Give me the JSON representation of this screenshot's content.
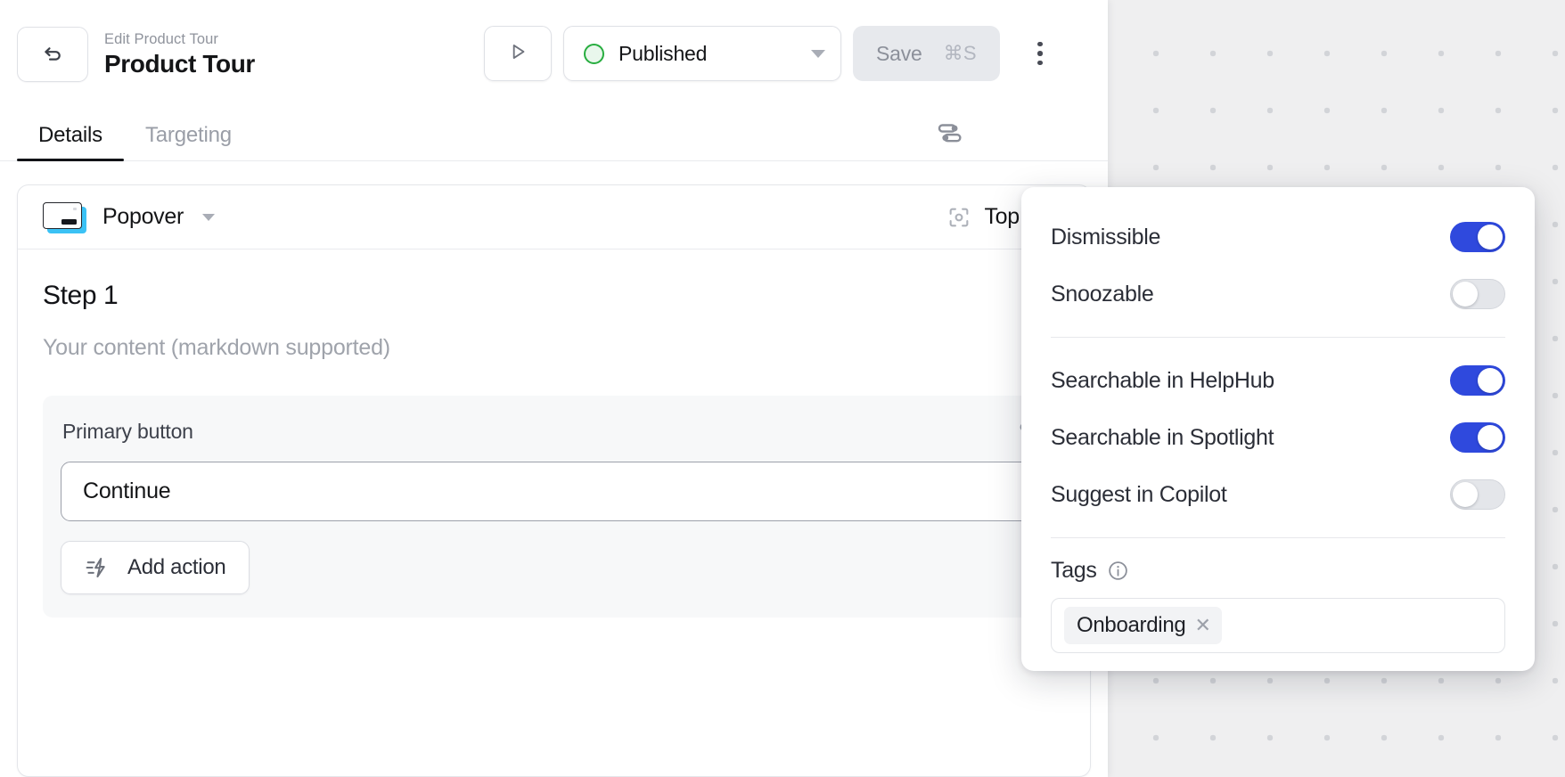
{
  "topbar": {
    "back_icon": "undo-arrow-icon",
    "eyebrow": "Edit Product Tour",
    "title": "Product Tour",
    "preview_icon": "play-triangle-icon",
    "status": {
      "label": "Published",
      "dot_color": "#27ad3f",
      "dot_fill": "#e9f7ec",
      "caret_icon": "chevron-down-icon"
    },
    "save": {
      "label": "Save",
      "shortcut": "⌘S",
      "disabled": true
    },
    "kebab_icon": "more-vertical-icon"
  },
  "tabs": {
    "items": [
      {
        "label": "Details",
        "active": true
      },
      {
        "label": "Targeting",
        "active": false
      }
    ],
    "settings_icon": "sliders-icon"
  },
  "step_card": {
    "type": {
      "icon": "popover-card-icon",
      "label": "Popover",
      "caret_icon": "chevron-down-icon"
    },
    "position": {
      "icon": "target-frame-icon",
      "label": "Top Left"
    },
    "step_title": "Step 1",
    "content_placeholder": "Your content (markdown supported)",
    "button_section": {
      "title": "Primary button",
      "settings_icon": "sliders-icon",
      "input_value": "Continue",
      "add_action": {
        "icon": "lightning-action-icon",
        "label": "Add action"
      }
    }
  },
  "settings_popover": {
    "group_one": [
      {
        "label": "Dismissible",
        "enabled": true
      },
      {
        "label": "Snoozable",
        "enabled": false
      }
    ],
    "group_two": [
      {
        "label": "Searchable in HelpHub",
        "enabled": true
      },
      {
        "label": "Searchable in Spotlight",
        "enabled": true
      },
      {
        "label": "Suggest in Copilot",
        "enabled": false
      }
    ],
    "tags": {
      "title": "Tags",
      "info_icon": "info-circle-icon",
      "chips": [
        {
          "label": "Onboarding",
          "remove_icon": "close-icon",
          "remove_glyph": "✕"
        }
      ]
    }
  },
  "colors": {
    "toggle_on": "#2f49dd",
    "toggle_off": "#e4e6ea",
    "status_green": "#27ad3f",
    "accent_cyan": "#3bc2f5",
    "canvas_bg": "#efeff0",
    "canvas_dot": "#d2d4d8"
  }
}
